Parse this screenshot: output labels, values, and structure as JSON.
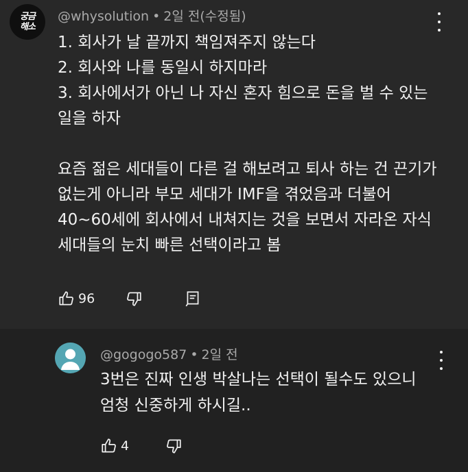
{
  "comment": {
    "avatar_text_line1": "궁금",
    "avatar_text_line2": "해소",
    "author": "@whysolution",
    "time": "2일 전(수정됨)",
    "text": "1. 회사가 날 끝까지 책임져주지 않는다\n2. 회사와 나를 동일시 하지마라\n3. 회사에서가 아닌 나 자신 혼자 힘으로 돈을 벌 수 있는 일을 하자\n\n요즘 젊은 세대들이 다른 걸 해보려고 퇴사 하는 건 끈기가 없는게 아니라 부모 세대가 IMF을 겪었음과 더불어 40~60세에 회사에서 내쳐지는 것을 보면서 자라온 자식 세대들의 눈치 빠른 선택이라고 봄",
    "like_count": "96"
  },
  "reply": {
    "author": "@gogogo587",
    "time": "2일 전",
    "text": "3번은 진짜 인생 박살나는 선택이 될수도 있으니 엄청 신중하게 하시길..",
    "like_count": "4"
  },
  "icons": {
    "like": "thumbs-up-icon",
    "dislike": "thumbs-down-icon",
    "reply": "reply-icon",
    "more": "more-vert-icon"
  }
}
